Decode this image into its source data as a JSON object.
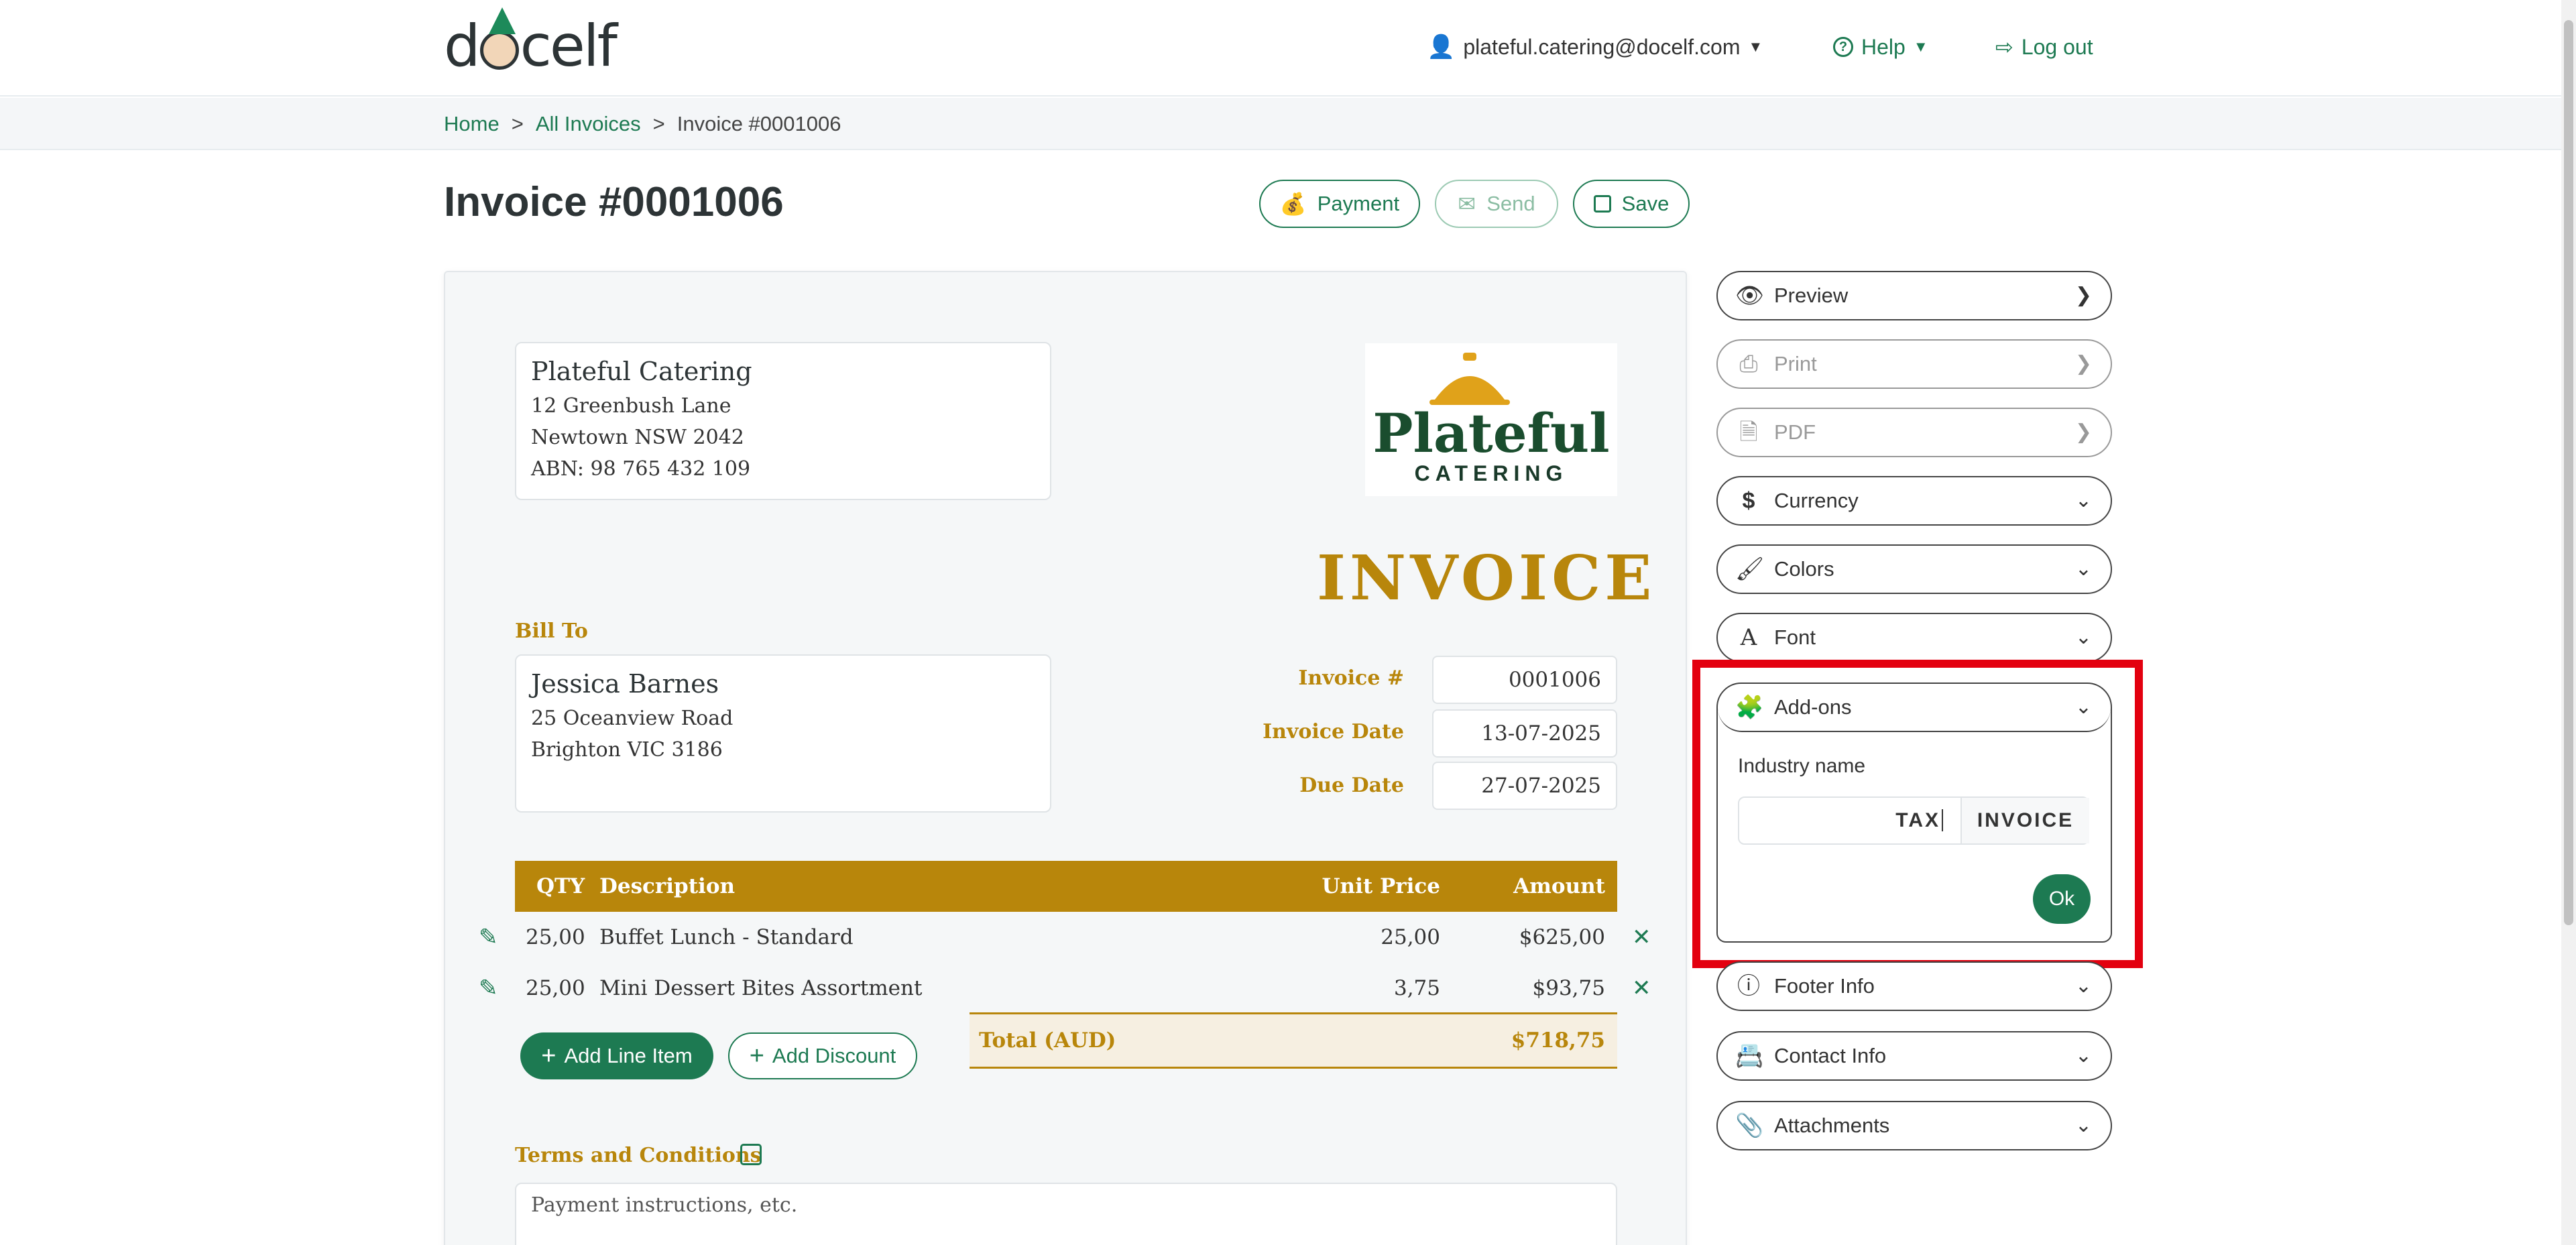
{
  "header": {
    "logo_text": "docelf",
    "user_email": "plateful.catering@docelf.com",
    "help_label": "Help",
    "logout_label": "Log out"
  },
  "breadcrumb": {
    "home": "Home",
    "sep": ">",
    "all_invoices": "All Invoices",
    "current": "Invoice #0001006"
  },
  "page": {
    "title": "Invoice #0001006",
    "payment_label": "Payment",
    "send_label": "Send",
    "save_label": "Save"
  },
  "invoice": {
    "company": {
      "name": "Plateful Catering",
      "line1": "12 Greenbush Lane",
      "line2": "Newtown NSW 2042",
      "line3": "ABN: 98 765 432 109"
    },
    "logo": {
      "word1": "Plateful",
      "word2": "CATERING"
    },
    "heading": "INVOICE",
    "bill_to_label": "Bill To",
    "client": {
      "name": "Jessica Barnes",
      "line1": "25 Oceanview Road",
      "line2": "Brighton VIC 3186"
    },
    "meta": {
      "number_label": "Invoice #",
      "number": "0001006",
      "date_label": "Invoice Date",
      "date": "13-07-2025",
      "due_label": "Due Date",
      "due": "27-07-2025"
    },
    "table": {
      "headers": {
        "qty": "QTY",
        "desc": "Description",
        "unit": "Unit Price",
        "amount": "Amount"
      },
      "rows": [
        {
          "qty": "25,00",
          "desc": "Buffet Lunch - Standard",
          "unit": "25,00",
          "amount": "$625,00"
        },
        {
          "qty": "25,00",
          "desc": "Mini Dessert Bites Assortment",
          "unit": "3,75",
          "amount": "$93,75"
        }
      ]
    },
    "add_line_label": "Add Line Item",
    "add_discount_label": "Add Discount",
    "total_label": "Total (AUD)",
    "total_value": "$718,75",
    "terms_label": "Terms and Conditions",
    "terms_placeholder": "Payment instructions, etc."
  },
  "sidebar": {
    "preview": "Preview",
    "print": "Print",
    "pdf": "PDF",
    "currency": "Currency",
    "colors": "Colors",
    "font": "Font",
    "addons": "Add-ons",
    "industry_label": "Industry name",
    "industry_value": "TAX",
    "industry_suffix": "INVOICE",
    "ok": "Ok",
    "footer_info": "Footer Info",
    "contact_info": "Contact Info",
    "attachments": "Attachments"
  },
  "colors": {
    "brand_green": "#1d7a52",
    "gold": "#b8860b",
    "highlight_red": "#e3000f"
  }
}
